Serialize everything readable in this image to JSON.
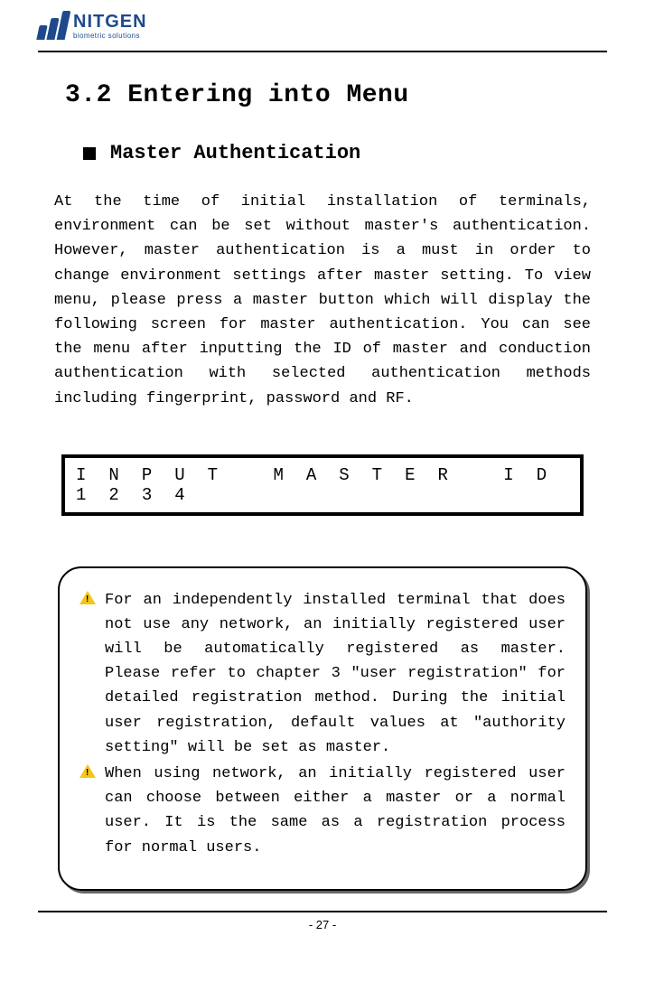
{
  "header": {
    "brand": "NITGEN",
    "tagline": "biometric solutions"
  },
  "section": {
    "title": "3.2 Entering into Menu",
    "subsection_title": "Master Authentication",
    "paragraph": "At the time of initial installation of terminals, environment can be set without master's authentication. However, master authentication is a must in order to change environment settings after master setting. To view menu, please press a master button which will display the following screen for master authentication. You can see the menu after inputting the ID of master and conduction authentication with selected authentication methods including fingerprint, password and RF."
  },
  "display": {
    "row1": [
      "I",
      "N",
      "P",
      "U",
      "T",
      "",
      "M",
      "A",
      "S",
      "T",
      "E",
      "R",
      "",
      "I",
      "D"
    ],
    "row2": [
      "1",
      "2",
      "3",
      "4",
      "",
      "",
      "",
      "",
      "",
      "",
      "",
      "",
      "",
      "",
      ""
    ]
  },
  "notices": [
    "For an independently installed terminal that does not use any network, an initially registered user will be automatically registered as master. Please refer to chapter 3 \"user registration\" for detailed registration method. During the initial user registration, default values at \"authority setting\" will be set as master.",
    "When using network, an initially registered user can choose between either a master or a normal user. It is the same as a registration process for normal users."
  ],
  "page_number": "- 27 -"
}
